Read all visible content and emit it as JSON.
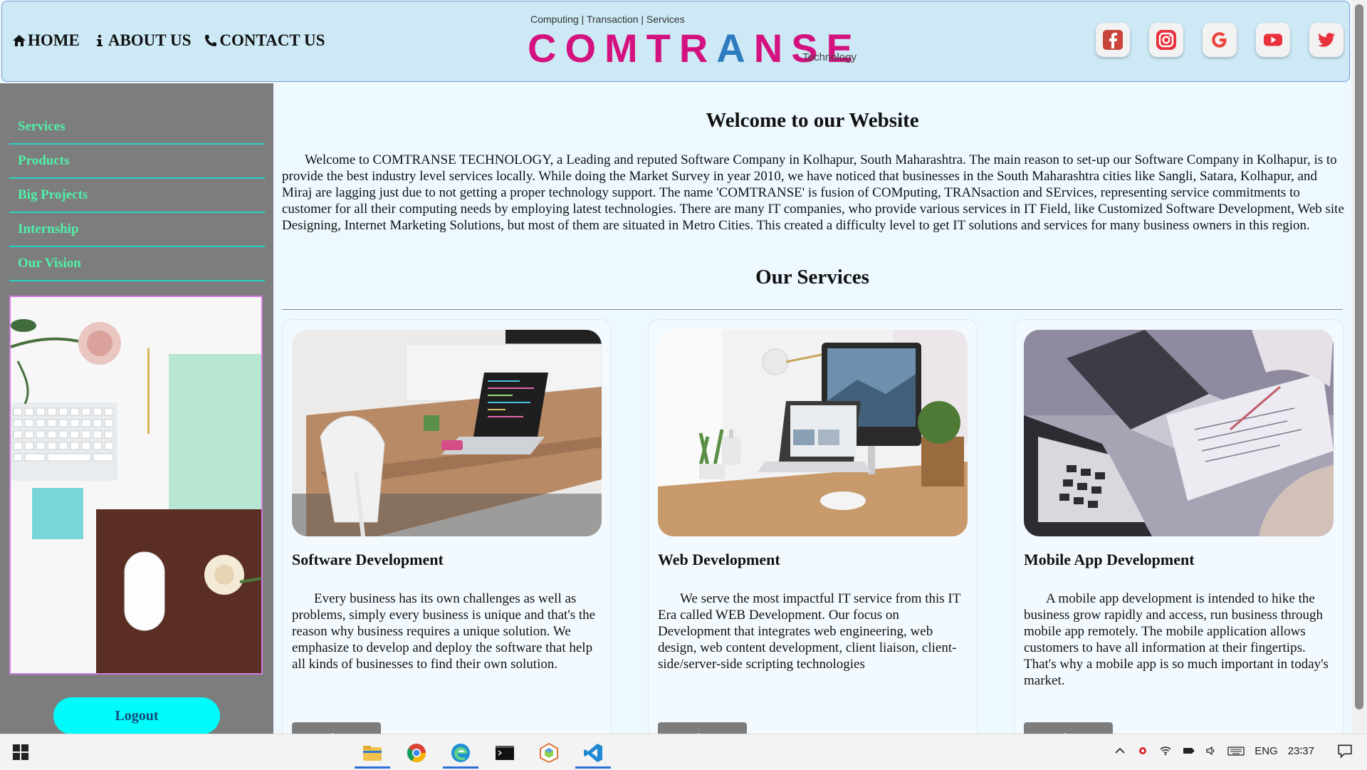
{
  "nav": {
    "home": "HOME",
    "about": "ABOUT US",
    "contact": "CONTACT US"
  },
  "logo": {
    "tagline": "Computing | Transaction | Services",
    "name_a": "COMTR",
    "name_arrow": "A",
    "name_b": "NSE",
    "subtitle": "Technology"
  },
  "socials": [
    "facebook-icon",
    "instagram-icon",
    "google-icon",
    "youtube-icon",
    "twitter-icon"
  ],
  "sidebar": {
    "items": [
      {
        "label": "Services"
      },
      {
        "label": "Products"
      },
      {
        "label": "Big Projects"
      },
      {
        "label": "Internship"
      },
      {
        "label": "Our Vision"
      }
    ],
    "logout": "Logout"
  },
  "main": {
    "welcome_title": "Welcome to our Website",
    "intro": "Welcome to COMTRANSE TECHNOLOGY, a Leading and reputed Software Company in Kolhapur, South Maharashtra. The main reason to set-up our Software Company in Kolhapur, is to provide the best industry level services locally. While doing the Market Survey in year 2010, we have noticed that businesses in the South Maharashtra cities like Sangli, Satara, Kolhapur, and Miraj are lagging just due to not getting a proper technology support. The name 'COMTRANSE' is fusion of COMputing, TRANsaction and SErvices, representing service commitments to customer for all their computing needs by employing latest technologies. There are many IT companies, who provide various services in IT Field, like Customized Software Development, Web site Designing, Internet Marketing Solutions, but most of them are situated in Metro Cities. This created a difficulty level to get IT solutions and services for many business owners in this region.",
    "services_title": "Our Services",
    "cards": [
      {
        "title": "Software Development",
        "text": "Every business has its own challenges as well as problems, simply every business is unique and that's the reason why business requires a unique solution. We emphasize to develop and deploy the software that help all kinds of businesses to find their own solution.",
        "button": "Read more"
      },
      {
        "title": "Web Development",
        "text": "We serve the most impactful IT service from this IT Era called WEB Development. Our focus on Development that integrates web engineering, web design, web content development, client liaison, client-side/server-side scripting technologies",
        "button": "Read more"
      },
      {
        "title": "Mobile App Development",
        "text": "A mobile app development is intended to hike the business grow rapidly and access, run business through mobile app remotely. The mobile application allows customers to have all information at their fingertips. That's why a mobile app is so much important in today's market.",
        "button": "Read more"
      }
    ]
  },
  "taskbar": {
    "apps": [
      "file-explorer-icon",
      "chrome-icon",
      "edge-icon",
      "terminal-icon",
      "app-cube-icon",
      "vscode-icon"
    ],
    "language": "ENG",
    "time": "23∶37"
  }
}
